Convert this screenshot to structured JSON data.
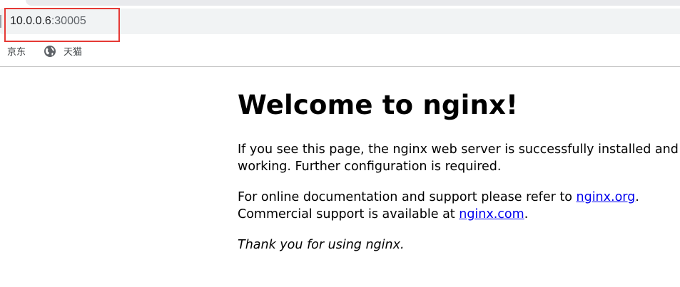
{
  "browser": {
    "url_host": "10.0.0.6",
    "url_port": ":30005",
    "bookmarks": [
      {
        "label": "京东",
        "icon": "none"
      },
      {
        "label": "天猫",
        "icon": "globe-icon"
      }
    ],
    "highlight_color": "#e53935"
  },
  "page": {
    "title": "Welcome to nginx!",
    "p1_line1": "If you see this page, the nginx web server is successfully installed and",
    "p1_line2": "working. Further configuration is required.",
    "p2_line1_prefix": "For online documentation and support please refer to ",
    "p2_link1": "nginx.org",
    "p2_line1_suffix": ".",
    "p2_line2_prefix": "Commercial support is available at ",
    "p2_link2": "nginx.com",
    "p2_line2_suffix": ".",
    "p3": "Thank you for using nginx.",
    "link_color": "#0000ee"
  }
}
